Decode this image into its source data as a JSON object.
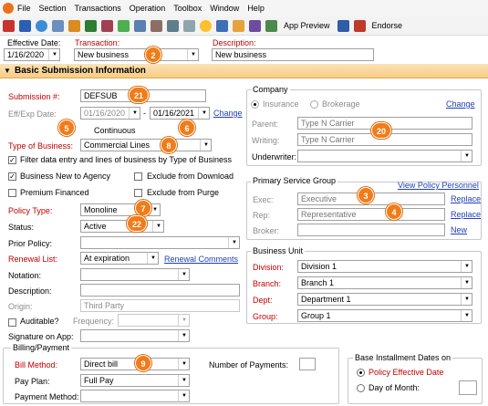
{
  "menu": {
    "items": [
      "File",
      "Section",
      "Transactions",
      "Operation",
      "Toolbox",
      "Window",
      "Help"
    ]
  },
  "toolbar": {
    "app_preview": "App Preview",
    "endorse": "Endorse"
  },
  "header": {
    "effective_date_label": "Effective Date:",
    "effective_date_value": "1/16/2020",
    "transaction_label": "Transaction:",
    "transaction_value": "New business",
    "description_label": "Description:",
    "description_value": "New business",
    "badge_2": "2"
  },
  "section_title": "Basic Submission Information",
  "left": {
    "submission_label": "Submission #:",
    "submission_value": "DEFSUB",
    "badge_21": "21",
    "eff_exp_label": "Eff/Exp Date:",
    "eff_date": "01/16/2020",
    "dash": "-",
    "exp_date": "01/16/2021",
    "change_link": "Change",
    "badge_5": "5",
    "badge_6": "6",
    "continuous_label": "Continuous",
    "type_business_label": "Type of Business:",
    "type_business_value": "Commercial Lines",
    "badge_8": "8",
    "filter_label": "Filter data entry and lines of business by Type of Business",
    "new_agency_label": "Business New to Agency",
    "exclude_download_label": "Exclude from Download",
    "premium_financed_label": "Premium Financed",
    "exclude_purge_label": "Exclude from Purge",
    "policy_type_label": "Policy Type:",
    "policy_type_value": "Monoline",
    "badge_7": "7",
    "status_label": "Status:",
    "status_value": "Active",
    "badge_22": "22",
    "prior_policy_label": "Prior Policy:",
    "renewal_list_label": "Renewal List:",
    "renewal_list_value": "At expiration",
    "renewal_comments_link": "Renewal Comments",
    "notation_label": "Notation:",
    "description_label": "Description:",
    "origin_label": "Origin:",
    "origin_value": "Third Party",
    "auditable_label": "Auditable?",
    "frequency_label": "Frequency:",
    "signature_label": "Signature on App:"
  },
  "billing": {
    "title": "Billing/Payment",
    "bill_method_label": "Bill Method:",
    "bill_method_value": "Direct bill",
    "badge_9": "9",
    "pay_plan_label": "Pay Plan:",
    "pay_plan_value": "Full Pay",
    "payment_method_label": "Payment Method:",
    "num_payments_label": "Number of Payments:",
    "base_title": "Base Installment Dates on",
    "policy_eff_date_label": "Policy Effective Date",
    "day_of_month_label": "Day of Month:"
  },
  "company": {
    "title": "Company",
    "insurance_label": "Insurance",
    "brokerage_label": "Brokerage",
    "change_link": "Change",
    "parent_label": "Parent:",
    "parent_placeholder": "Type N Carrier",
    "writing_label": "Writing:",
    "writing_placeholder": "Type N Carrier",
    "badge_20": "20",
    "underwriter_label": "Underwriter:"
  },
  "service_group": {
    "title": "Primary Service Group",
    "view_link": "View Policy Personnel",
    "exec_label": "Exec:",
    "exec_placeholder": "Executive",
    "badge_3": "3",
    "replace1": "Replace",
    "rep_label": "Rep:",
    "rep_placeholder": "Representative",
    "badge_4": "4",
    "replace2": "Replace",
    "broker_label": "Broker:",
    "new_link": "New"
  },
  "business_unit": {
    "title": "Business Unit",
    "division_label": "Division:",
    "division_value": "Division 1",
    "branch_label": "Branch:",
    "branch_value": "Branch 1",
    "dept_label": "Dept:",
    "dept_value": "Department 1",
    "group_label": "Group:",
    "group_value": "Group 1"
  },
  "colors": {
    "accent_red": "#c00000",
    "badge_orange": "#f07c1a",
    "link_blue": "#1f3fb8",
    "section_bar": "#f7cd85"
  }
}
